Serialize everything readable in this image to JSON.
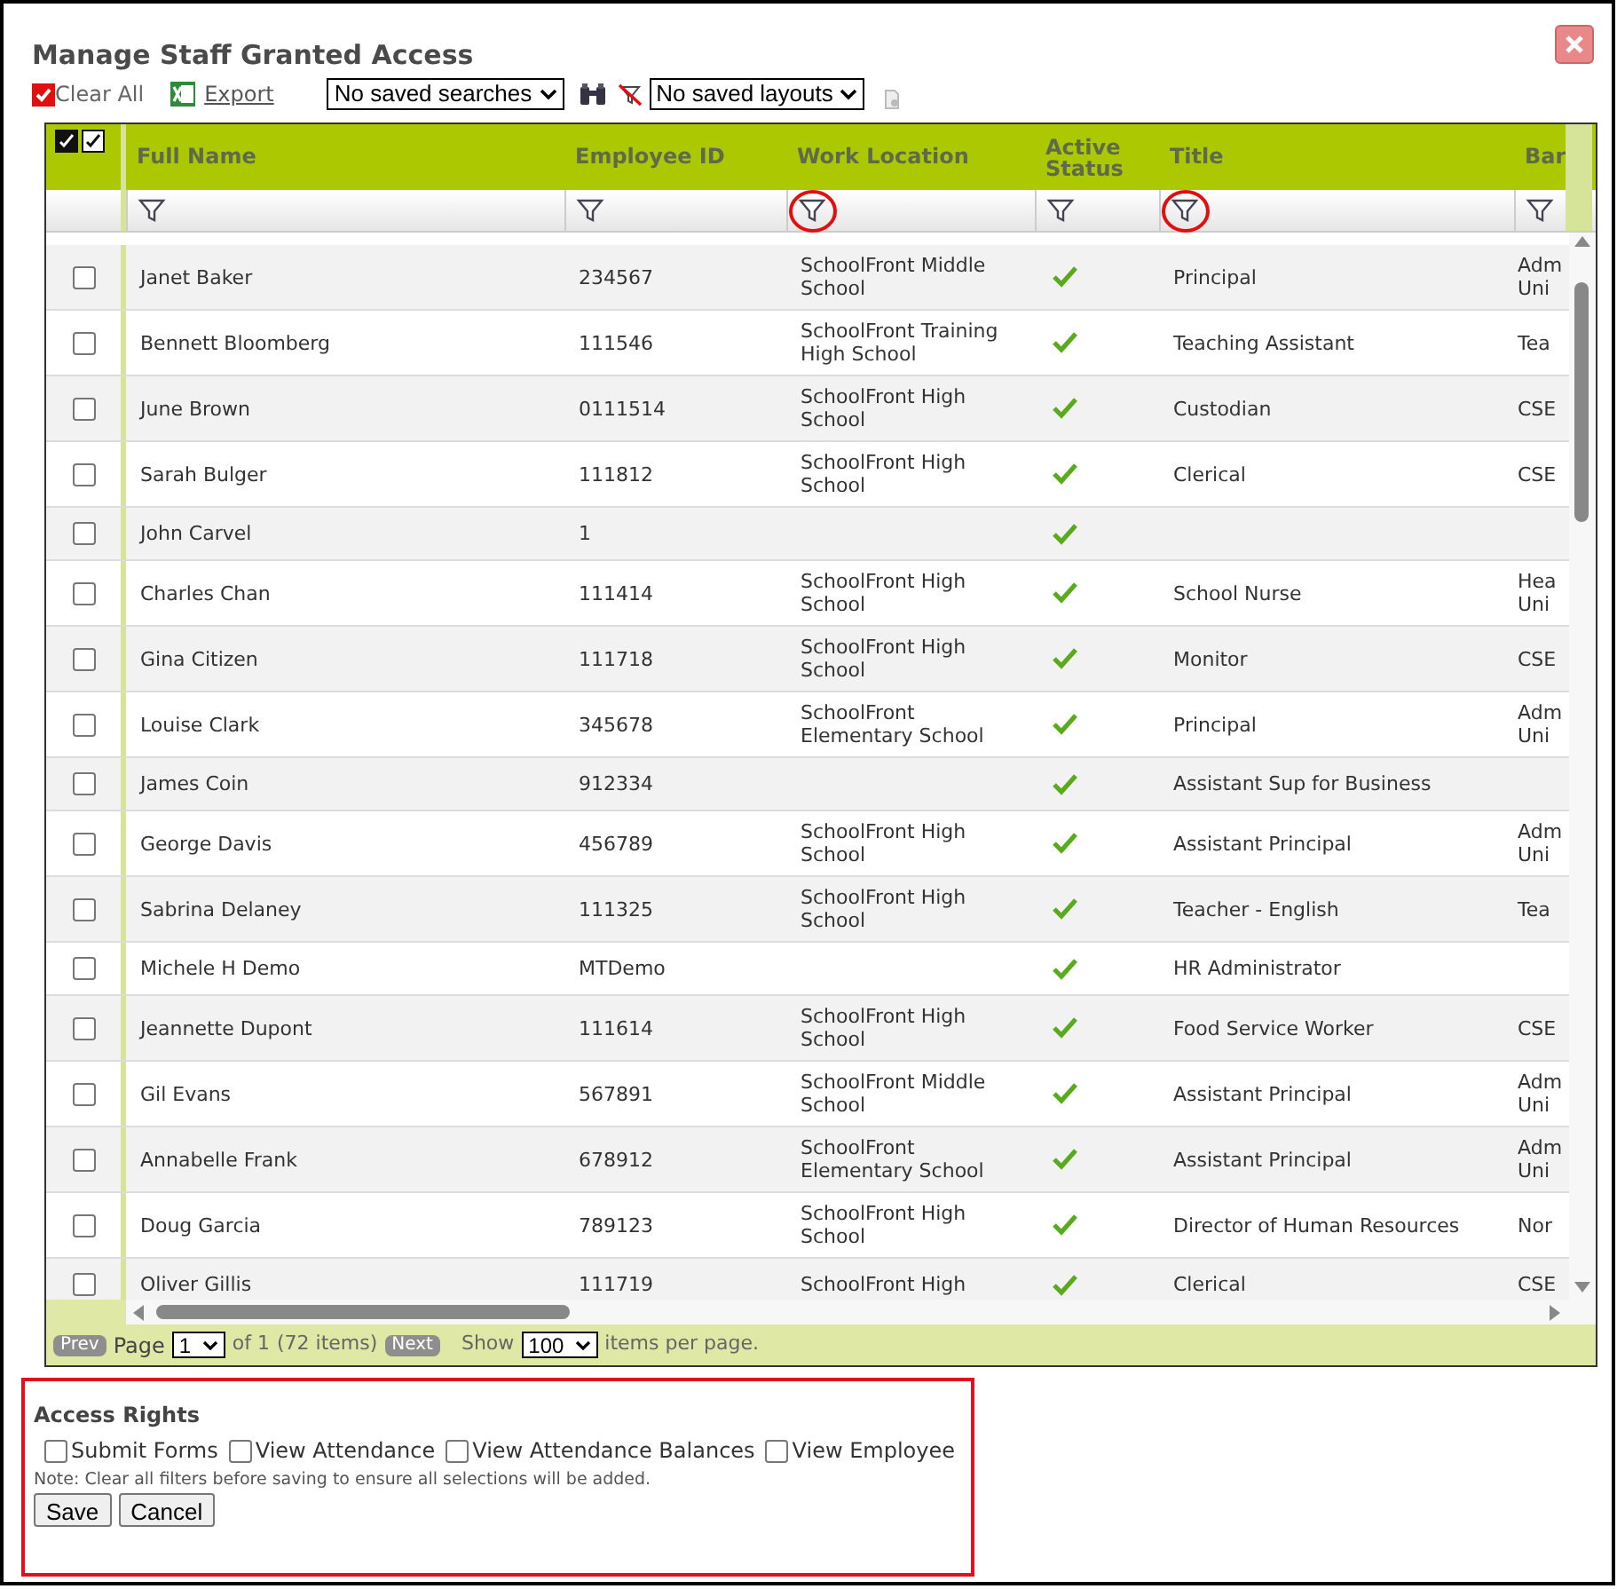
{
  "dialog": {
    "title": "Manage Staff Granted Access"
  },
  "toolbar": {
    "clear_all": {
      "label": "Clear All",
      "checked": true
    },
    "export": {
      "label": "Export"
    },
    "saved_searches": {
      "value": "No saved searches"
    },
    "saved_layouts": {
      "value": "No saved layouts"
    }
  },
  "table": {
    "columns": [
      {
        "label": "Full Name",
        "filter_highlighted": false
      },
      {
        "label": "Employee ID",
        "filter_highlighted": false
      },
      {
        "label": "Work Location",
        "filter_highlighted": true
      },
      {
        "label": "Active Status",
        "filter_highlighted": false
      },
      {
        "label": "Title",
        "filter_highlighted": true
      },
      {
        "label": "Bar",
        "filter_highlighted": false
      }
    ],
    "rows": [
      {
        "name": "Janet Baker",
        "id": "234567",
        "location": "SchoolFront Middle School",
        "active": true,
        "title": "Principal",
        "column_6": "Adm Uni",
        "checked": false
      },
      {
        "name": "Bennett Bloomberg",
        "id": "111546",
        "location": "SchoolFront Training High School",
        "active": true,
        "title": "Teaching Assistant",
        "column_6": "Tea",
        "checked": false
      },
      {
        "name": "June Brown",
        "id": "0111514",
        "location": "SchoolFront High School",
        "active": true,
        "title": "Custodian",
        "column_6": "CSE",
        "checked": false
      },
      {
        "name": "Sarah Bulger",
        "id": "111812",
        "location": "SchoolFront High School",
        "active": true,
        "title": "Clerical",
        "column_6": "CSE",
        "checked": false
      },
      {
        "name": "John Carvel",
        "id": "1",
        "active": true,
        "checked": false
      },
      {
        "name": "Charles Chan",
        "id": "111414",
        "location": "SchoolFront High School",
        "active": true,
        "title": "School Nurse",
        "column_6": "Hea Uni",
        "checked": false
      },
      {
        "name": "Gina Citizen",
        "id": "111718",
        "location": "SchoolFront High School",
        "active": true,
        "title": "Monitor",
        "column_6": "CSE",
        "checked": false
      },
      {
        "name": "Louise Clark",
        "id": "345678",
        "location": "SchoolFront Elementary School",
        "active": true,
        "title": "Principal",
        "column_6": "Adm Uni",
        "checked": false
      },
      {
        "name": "James Coin",
        "id": "912334",
        "active": true,
        "title": "Assistant Sup for Business",
        "checked": false
      },
      {
        "name": "George Davis",
        "id": "456789",
        "location": "SchoolFront High School",
        "active": true,
        "title": "Assistant Principal",
        "column_6": "Adm Uni",
        "checked": false
      },
      {
        "name": "Sabrina Delaney",
        "id": "111325",
        "location": "SchoolFront High School",
        "active": true,
        "title": "Teacher - English",
        "column_6": "Tea",
        "checked": false
      },
      {
        "name": "Michele H Demo",
        "id": "MTDemo",
        "active": true,
        "title": "HR Administrator",
        "checked": false
      },
      {
        "name": "Jeannette Dupont",
        "id": "111614",
        "location": "SchoolFront High School",
        "active": true,
        "title": "Food Service Worker",
        "column_6": "CSE",
        "checked": false
      },
      {
        "name": "Gil Evans",
        "id": "567891",
        "location": "SchoolFront Middle School",
        "active": true,
        "title": "Assistant Principal",
        "column_6": "Adm Uni",
        "checked": false
      },
      {
        "name": "Annabelle Frank",
        "id": "678912",
        "location": "SchoolFront Elementary School",
        "active": true,
        "title": "Assistant Principal",
        "column_6": "Adm Uni",
        "checked": false
      },
      {
        "name": "Doug Garcia",
        "id": "789123",
        "location": "SchoolFront High School",
        "active": true,
        "title": "Director of Human Resources",
        "column_6": "Nor",
        "checked": false
      },
      {
        "name": "Oliver Gillis",
        "id": "111719",
        "location": "SchoolFront High",
        "active": true,
        "title": "Clerical",
        "column_6": "CSE",
        "checked": false
      }
    ]
  },
  "pager": {
    "prev": "Prev",
    "page_label": "Page",
    "page": "1",
    "of": "of 1",
    "items": "(72 items)",
    "next": "Next",
    "show_label": "Show",
    "per_page": "100",
    "per_page_label": "items per page."
  },
  "access_rights": {
    "title": "Access Rights",
    "options": [
      {
        "label": "Submit Forms",
        "checked": false
      },
      {
        "label": "View Attendance",
        "checked": false
      },
      {
        "label": "View Attendance Balances",
        "checked": false
      },
      {
        "label": "View Employee",
        "checked": false
      }
    ],
    "note": "Note: Clear all filters before saving to ensure all selections will be added.",
    "buttons": [
      "Save",
      "Cancel"
    ]
  }
}
